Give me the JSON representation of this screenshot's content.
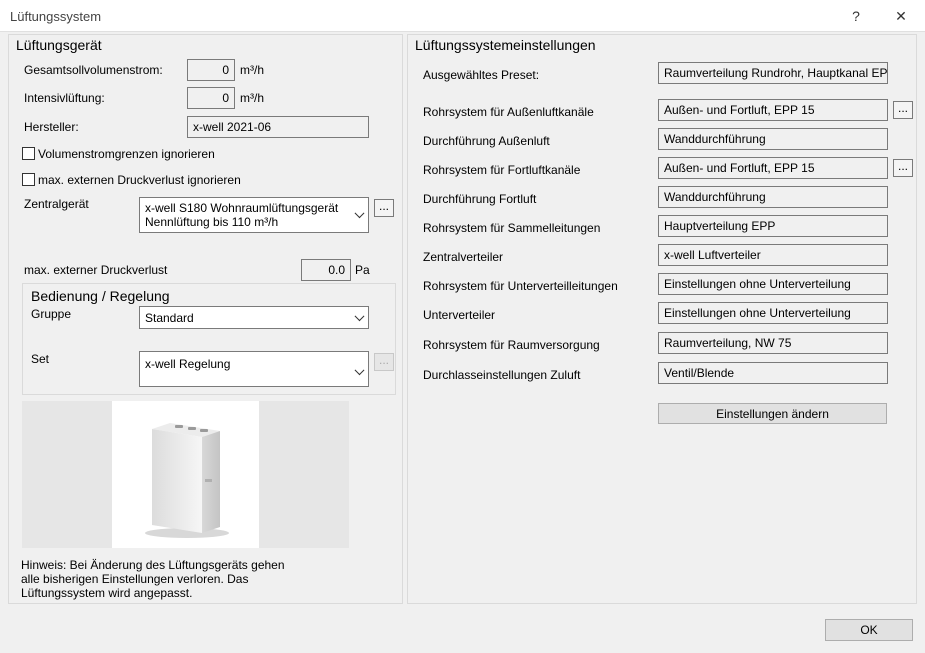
{
  "window": {
    "title": "Lüftungssystem",
    "help_label": "?",
    "close_label": "✕"
  },
  "left": {
    "title": "Lüftungsgerät",
    "gesamt": {
      "label": "Gesamtsollvolumenstrom:",
      "value": "0",
      "unit": "m³/h"
    },
    "intensiv": {
      "label": "Intensivlüftung:",
      "value": "0",
      "unit": "m³/h"
    },
    "hersteller": {
      "label": "Hersteller:",
      "value": "x-well 2021-06"
    },
    "chk_volumen": {
      "label": "Volumenstromgrenzen ignorieren",
      "checked": false
    },
    "chk_druck": {
      "label": "max. externen Druckverlust ignorieren",
      "checked": false
    },
    "zentral": {
      "label": "Zentralgerät",
      "line1": "x-well S180 Wohnraumlüftungsgerät",
      "line2": "Nennlüftung bis 110 m³/h",
      "dots": "..."
    },
    "druckverlust": {
      "label": "max. externer Druckverlust",
      "value": "0.0",
      "unit": "Pa"
    },
    "bedienung": {
      "title": "Bedienung / Regelung",
      "gruppe_label": "Gruppe",
      "gruppe_value": "Standard",
      "set_label": "Set",
      "set_value": "x-well Regelung",
      "dots": "..."
    },
    "hinweis": "Hinweis: Bei Änderung des Lüftungsgeräts gehen alle bisherigen Einstellungen verloren. Das Lüftungssystem wird angepasst."
  },
  "right": {
    "title": "Lüftungssystemeinstellungen",
    "rows": [
      {
        "label": "Ausgewähltes Preset:",
        "value": "Raumverteilung Rundrohr, Hauptkanal EPP-Ro"
      },
      {
        "label": "Rohrsystem für Außenluftkanäle",
        "value": "Außen- und Fortluft, EPP 15",
        "dots": "..."
      },
      {
        "label": "Durchführung Außenluft",
        "value": "Wanddurchführung"
      },
      {
        "label": "Rohrsystem für Fortluftkanäle",
        "value": "Außen- und Fortluft, EPP 15",
        "dots": "..."
      },
      {
        "label": "Durchführung Fortluft",
        "value": "Wanddurchführung"
      },
      {
        "label": "Rohrsystem für Sammelleitungen",
        "value": "Hauptverteilung EPP"
      },
      {
        "label": "Zentralverteiler",
        "value": "x-well Luftverteiler"
      },
      {
        "label": "Rohrsystem für Unterverteilleitungen",
        "value": "Einstellungen ohne Unterverteilung"
      },
      {
        "label": "Unterverteiler",
        "value": "Einstellungen ohne Unterverteilung"
      },
      {
        "label": "Rohrsystem für Raumversorgung",
        "value": "Raumverteilung, NW 75"
      },
      {
        "label": "Durchlasseinstellungen Zuluft",
        "value": "Ventil/Blende"
      }
    ],
    "change_button": "Einstellungen ändern"
  },
  "ok_button": "OK"
}
